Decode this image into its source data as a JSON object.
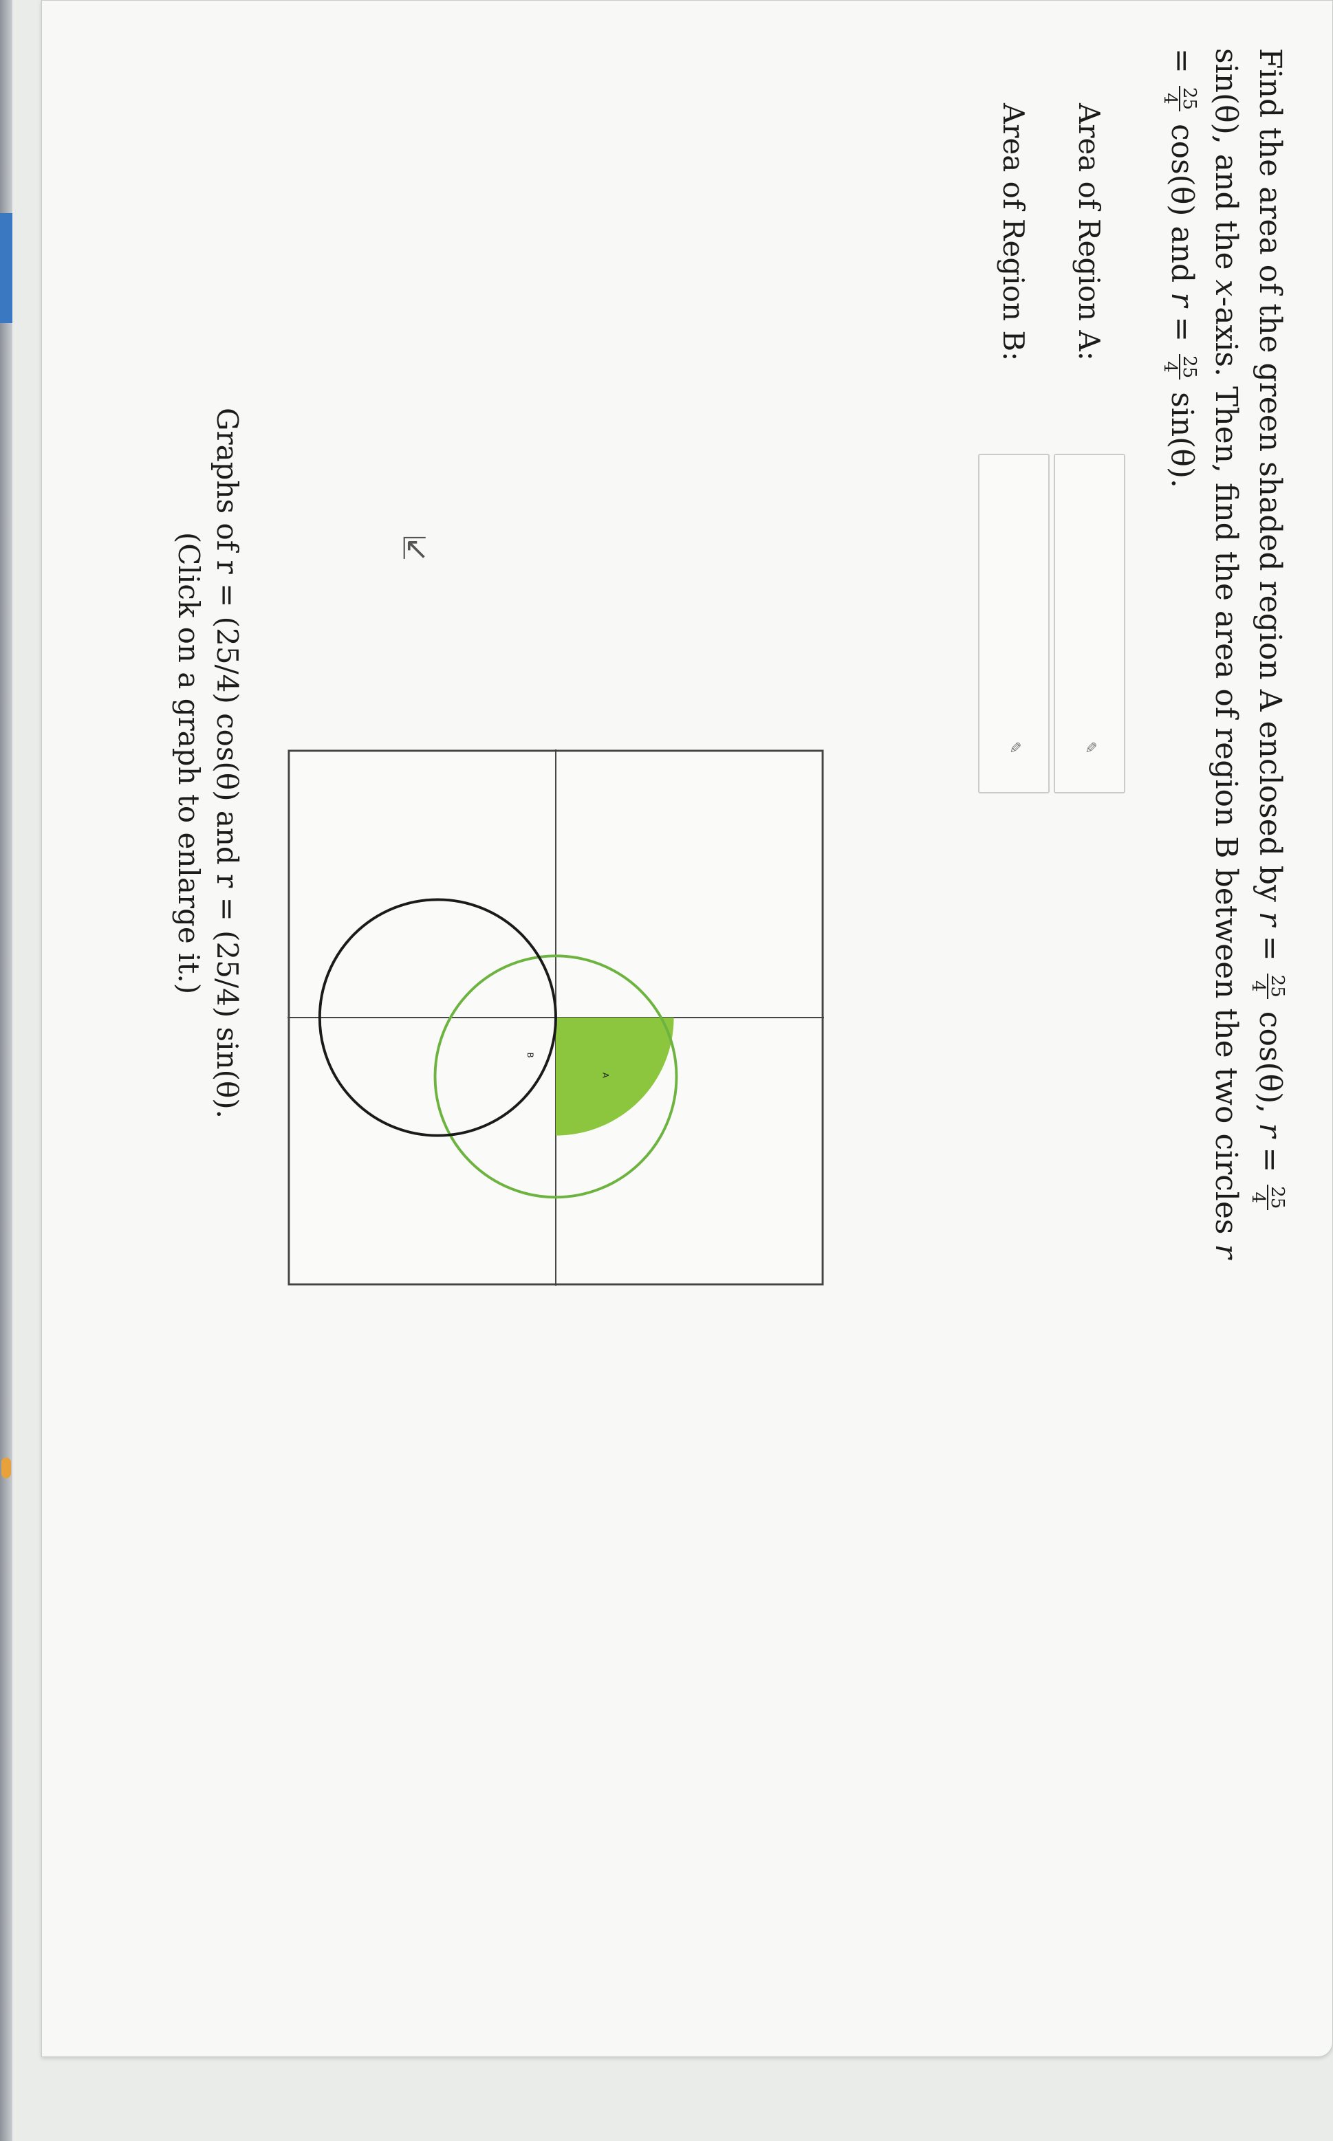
{
  "problem": {
    "part1": "Find the area of the green shaded region A enclosed by ",
    "r": "r",
    "eq": " = ",
    "frac_num": "25",
    "frac_den": "4",
    "cos": " cos(θ), ",
    "sin": " sin(θ), ",
    "part2": "and the ",
    "xvar": "x",
    "part3": "-axis. Then, find the area of region B between the two circles ",
    "and": " and ",
    "end": " sin(θ).",
    "cos_plain": " cos(θ)"
  },
  "answers": {
    "region_a_label": "Area of Region A:",
    "region_b_label": "Area of Region B:",
    "region_a_value": "",
    "region_b_value": ""
  },
  "graph": {
    "caption_line1": "Graphs of r = (25/4) cos(θ) and r = (25/4) sin(θ).",
    "caption_line2": "(Click on a graph to enlarge it.)",
    "label_a": "A",
    "label_b": "B",
    "green_color": "#6db33f",
    "curve_color": "#1a1a1a"
  }
}
